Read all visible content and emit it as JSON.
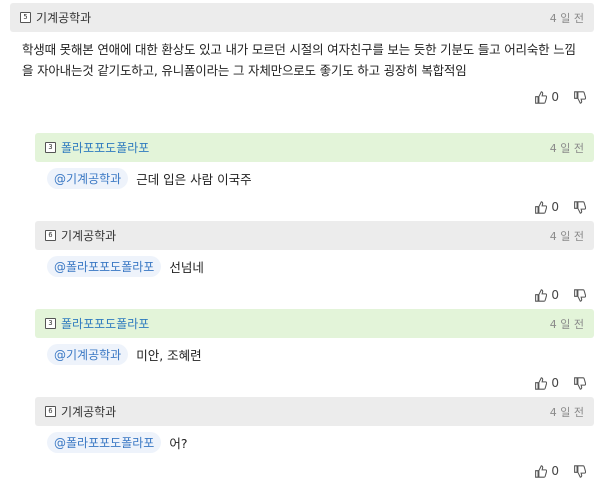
{
  "root": {
    "badge": "5",
    "author": "기계공학과",
    "time": "4 일 전",
    "body": "학생때 못해본 연애에 대한 환상도 있고 내가 모르던 시절의 여자친구를 보는 듯한 기분도 들고 어리숙한 느낌을 자아내는것 같기도하고, 유니폼이라는 그 자체만으로도 좋기도 하고 굉장히 복합적임",
    "likes": "0"
  },
  "replies": [
    {
      "badge": "3",
      "author": "폴라포포도폴라포",
      "time": "4 일 전",
      "mention": "@기계공학과",
      "text": "근데 입은 사람 이국주",
      "likes": "0"
    },
    {
      "badge": "6",
      "author": "기계공학과",
      "time": "4 일 전",
      "mention": "@폴라포포도폴라포",
      "text": "선넘네",
      "likes": "0"
    },
    {
      "badge": "3",
      "author": "폴라포포도폴라포",
      "time": "4 일 전",
      "mention": "@기계공학과",
      "text": "미안, 조혜련",
      "likes": "0"
    },
    {
      "badge": "6",
      "author": "기계공학과",
      "time": "4 일 전",
      "mention": "@폴라포포도폴라포",
      "text": "어?",
      "likes": "0"
    }
  ],
  "colors": {
    "header_gray": "#ececec",
    "header_green": "#e3f4d9",
    "mention_bg": "#eef3fb",
    "mention_text": "#3a78c4"
  },
  "icons": {
    "like": "thumbs-up-icon",
    "dislike": "thumbs-down-icon"
  }
}
